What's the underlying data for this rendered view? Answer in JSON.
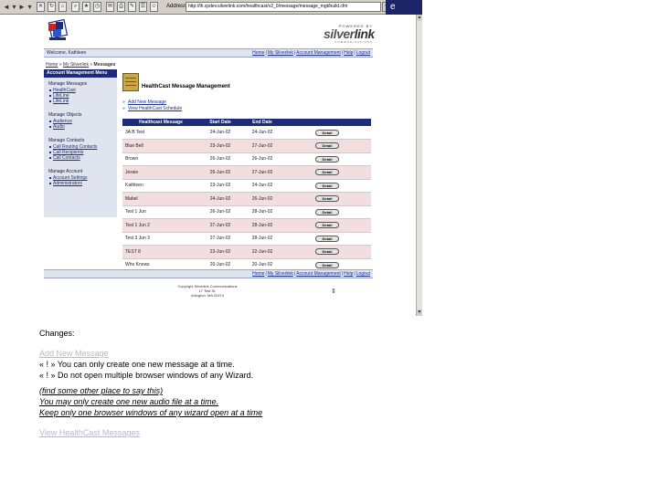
{
  "browser": {
    "address_label": "Address",
    "url": "http://lh.cpdev.silverlink.com/healthcast/v2_0/message/message_mgt/build.cfm"
  },
  "header": {
    "brand_top": "POWERED BY",
    "brand_name_a": "silver",
    "brand_name_b": "link",
    "brand_sub": "COMMUNICATIONS",
    "welcome": "Welcome, Kathleen",
    "links": [
      "Home",
      "My Silverlink",
      "Account Management",
      "Help",
      "Logout"
    ]
  },
  "breadcrumb": {
    "home": "Home",
    "mid": "My Silverlink",
    "current": "Messages"
  },
  "left_menu": {
    "title": "Account Management Menu",
    "groups": [
      {
        "title": "Manage Messages",
        "items": [
          "HealthCast",
          "LifeLine",
          "LifeLink"
        ]
      },
      {
        "title": "Manage Objects",
        "items": [
          "Audience",
          "Audio"
        ]
      },
      {
        "title": "Manage Contacts",
        "items": [
          "Call Routing Contacts",
          "Call Recipients",
          "Call Contacts"
        ]
      },
      {
        "title": "Manage Account",
        "items": [
          "Account Settings",
          "Administrators"
        ]
      }
    ]
  },
  "content": {
    "title": "HealthCast Message Management",
    "actions": [
      "Add New Message",
      "View HealthCast Schedule"
    ]
  },
  "table": {
    "headers": [
      "Healthcast Message",
      "Start Date",
      "End Date"
    ],
    "detail_label": "Detail",
    "rows": [
      {
        "name": "3A B Test",
        "start": "24-Jun-02",
        "end": "24-Jun-02"
      },
      {
        "name": "Blue Bell",
        "start": "23-Jun-02",
        "end": "27-Jun-02"
      },
      {
        "name": "Brown",
        "start": "26-Jun-02",
        "end": "26-Jun-02"
      },
      {
        "name": "Jessie",
        "start": "26-Jun-02",
        "end": "27-Jun-02"
      },
      {
        "name": "Kathleen",
        "start": "23-Jun-02",
        "end": "24-Jun-02"
      },
      {
        "name": "Mabel",
        "start": "24-Jun-02",
        "end": "26-Jun-02"
      },
      {
        "name": "Test 1 Jun",
        "start": "26-Jun-02",
        "end": "28-Jun-02"
      },
      {
        "name": "Test 1 Jun 2",
        "start": "27-Jun-02",
        "end": "28-Jun-02"
      },
      {
        "name": "Test 3 Jun 3",
        "start": "27-Jun-02",
        "end": "28-Jun-02"
      },
      {
        "name": "TEST 8",
        "start": "23-Jun-02",
        "end": "22-Jun-02"
      },
      {
        "name": "Who Knows",
        "start": "20-Jun-02",
        "end": "20-Jun-02"
      }
    ]
  },
  "footer": {
    "links": [
      "Home",
      "My Silverlink",
      "Account Management",
      "Help",
      "Logout"
    ],
    "copyright_1": "Copyright Silverlink Communications",
    "copyright_2": "17 Test St.",
    "copyright_3": "Arlington, MA 02474"
  },
  "notes": {
    "changes": "Changes:",
    "add_new": "Add New Message",
    "rule1": "« ! » You can only create one new message at a time.",
    "rule2": "« ! » Do not open multiple browser windows of any Wizard.",
    "aside": "(find some other place to say this)",
    "aside1": "You may only create one new audio file at a time.",
    "aside2": "Keep only one browser windows of any wizard open at a time",
    "view_link": "View HealthCast Messages"
  }
}
